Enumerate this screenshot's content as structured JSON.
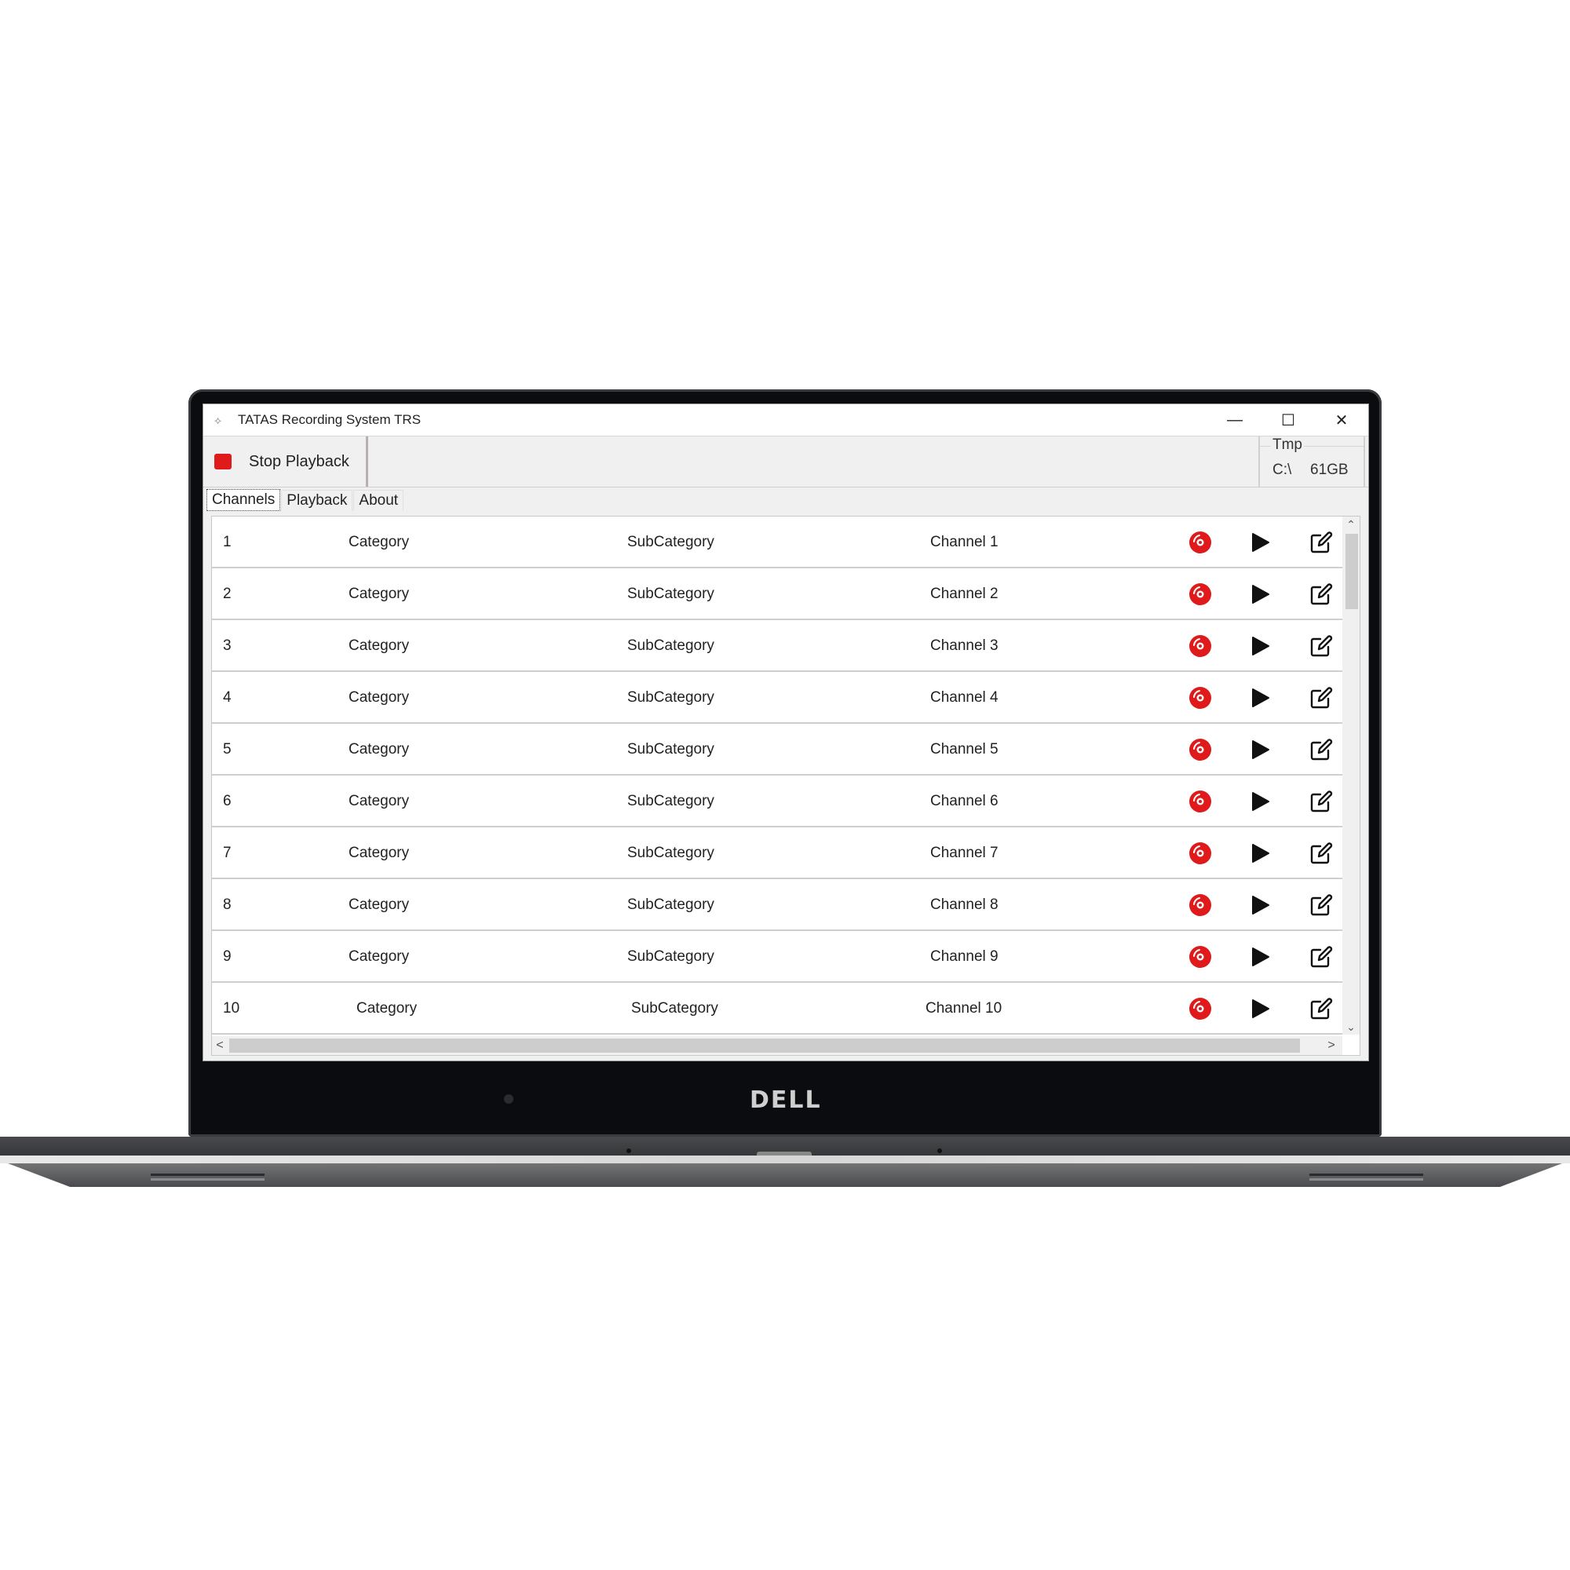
{
  "device": {
    "brand": "DELL"
  },
  "window": {
    "title": "TATAS Recording System TRS",
    "controls": {
      "minimize": "—",
      "maximize": "☐",
      "close": "✕"
    }
  },
  "toolbar": {
    "stop_label": "Stop Playback",
    "stop_color": "#e01a1a",
    "storage": {
      "title": "Tmp",
      "drive": "C:\\",
      "free": "61GB"
    }
  },
  "tabs": [
    {
      "label": "Channels",
      "active": true
    },
    {
      "label": "Playback",
      "active": false
    },
    {
      "label": "About",
      "active": false
    }
  ],
  "channels": [
    {
      "num": "1",
      "category": "Category",
      "subcategory": "SubCategory",
      "channel": "Channel 1"
    },
    {
      "num": "2",
      "category": "Category",
      "subcategory": "SubCategory",
      "channel": "Channel 2"
    },
    {
      "num": "3",
      "category": "Category",
      "subcategory": "SubCategory",
      "channel": "Channel 3"
    },
    {
      "num": "4",
      "category": "Category",
      "subcategory": "SubCategory",
      "channel": "Channel 4"
    },
    {
      "num": "5",
      "category": "Category",
      "subcategory": "SubCategory",
      "channel": "Channel 5"
    },
    {
      "num": "6",
      "category": "Category",
      "subcategory": "SubCategory",
      "channel": "Channel 6"
    },
    {
      "num": "7",
      "category": "Category",
      "subcategory": "SubCategory",
      "channel": "Channel 7"
    },
    {
      "num": "8",
      "category": "Category",
      "subcategory": "SubCategory",
      "channel": "Channel 8"
    },
    {
      "num": "9",
      "category": "Category",
      "subcategory": "SubCategory",
      "channel": "Channel 9"
    },
    {
      "num": "10",
      "category": "Category",
      "subcategory": "SubCategory",
      "channel": "Channel 10"
    }
  ],
  "row_icons": {
    "record": "record-icon",
    "play": "play-icon",
    "edit": "edit-icon",
    "record_color": "#e01a1a"
  },
  "scrollbars": {
    "up": "⌃",
    "down": "⌄",
    "left": "<",
    "right": ">"
  }
}
